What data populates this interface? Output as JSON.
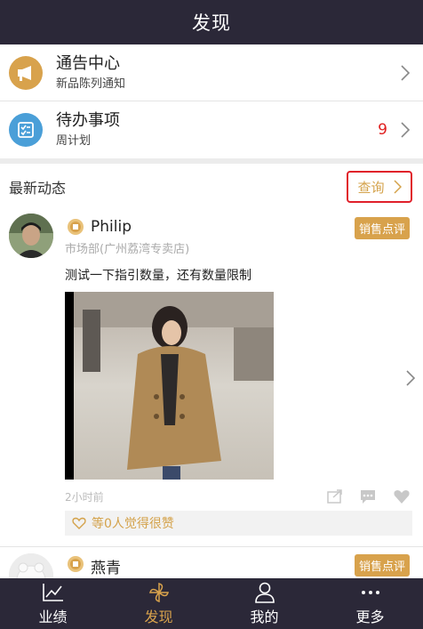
{
  "header": {
    "title": "发现"
  },
  "menu": [
    {
      "title": "通告中心",
      "subtitle": "新品陈列通知",
      "icon": "megaphone-icon",
      "color": "#d8a24c",
      "badge": ""
    },
    {
      "title": "待办事项",
      "subtitle": "周计划",
      "icon": "checklist-icon",
      "color": "#4a9fd8",
      "badge": "9"
    }
  ],
  "section": {
    "title": "最新动态",
    "query_label": "查询"
  },
  "posts": [
    {
      "name": "Philip",
      "dept": "市场部(广州荔湾专卖店)",
      "tag": "销售点评",
      "text": "测试一下指引数量，还有数量限制",
      "time": "2小时前",
      "likes": "等0人觉得很赞"
    },
    {
      "name": "燕青",
      "tag": "销售点评"
    }
  ],
  "tabs": [
    {
      "label": "业绩",
      "icon": "chart-icon",
      "active": false
    },
    {
      "label": "发现",
      "icon": "pinwheel-icon",
      "active": true
    },
    {
      "label": "我的",
      "icon": "user-icon",
      "active": false
    },
    {
      "label": "更多",
      "icon": "more-icon",
      "active": false
    }
  ],
  "colors": {
    "header_bg": "#2b2838",
    "accent": "#d8a24c",
    "badge": "#e02020",
    "highlight_border": "#e0202a"
  }
}
